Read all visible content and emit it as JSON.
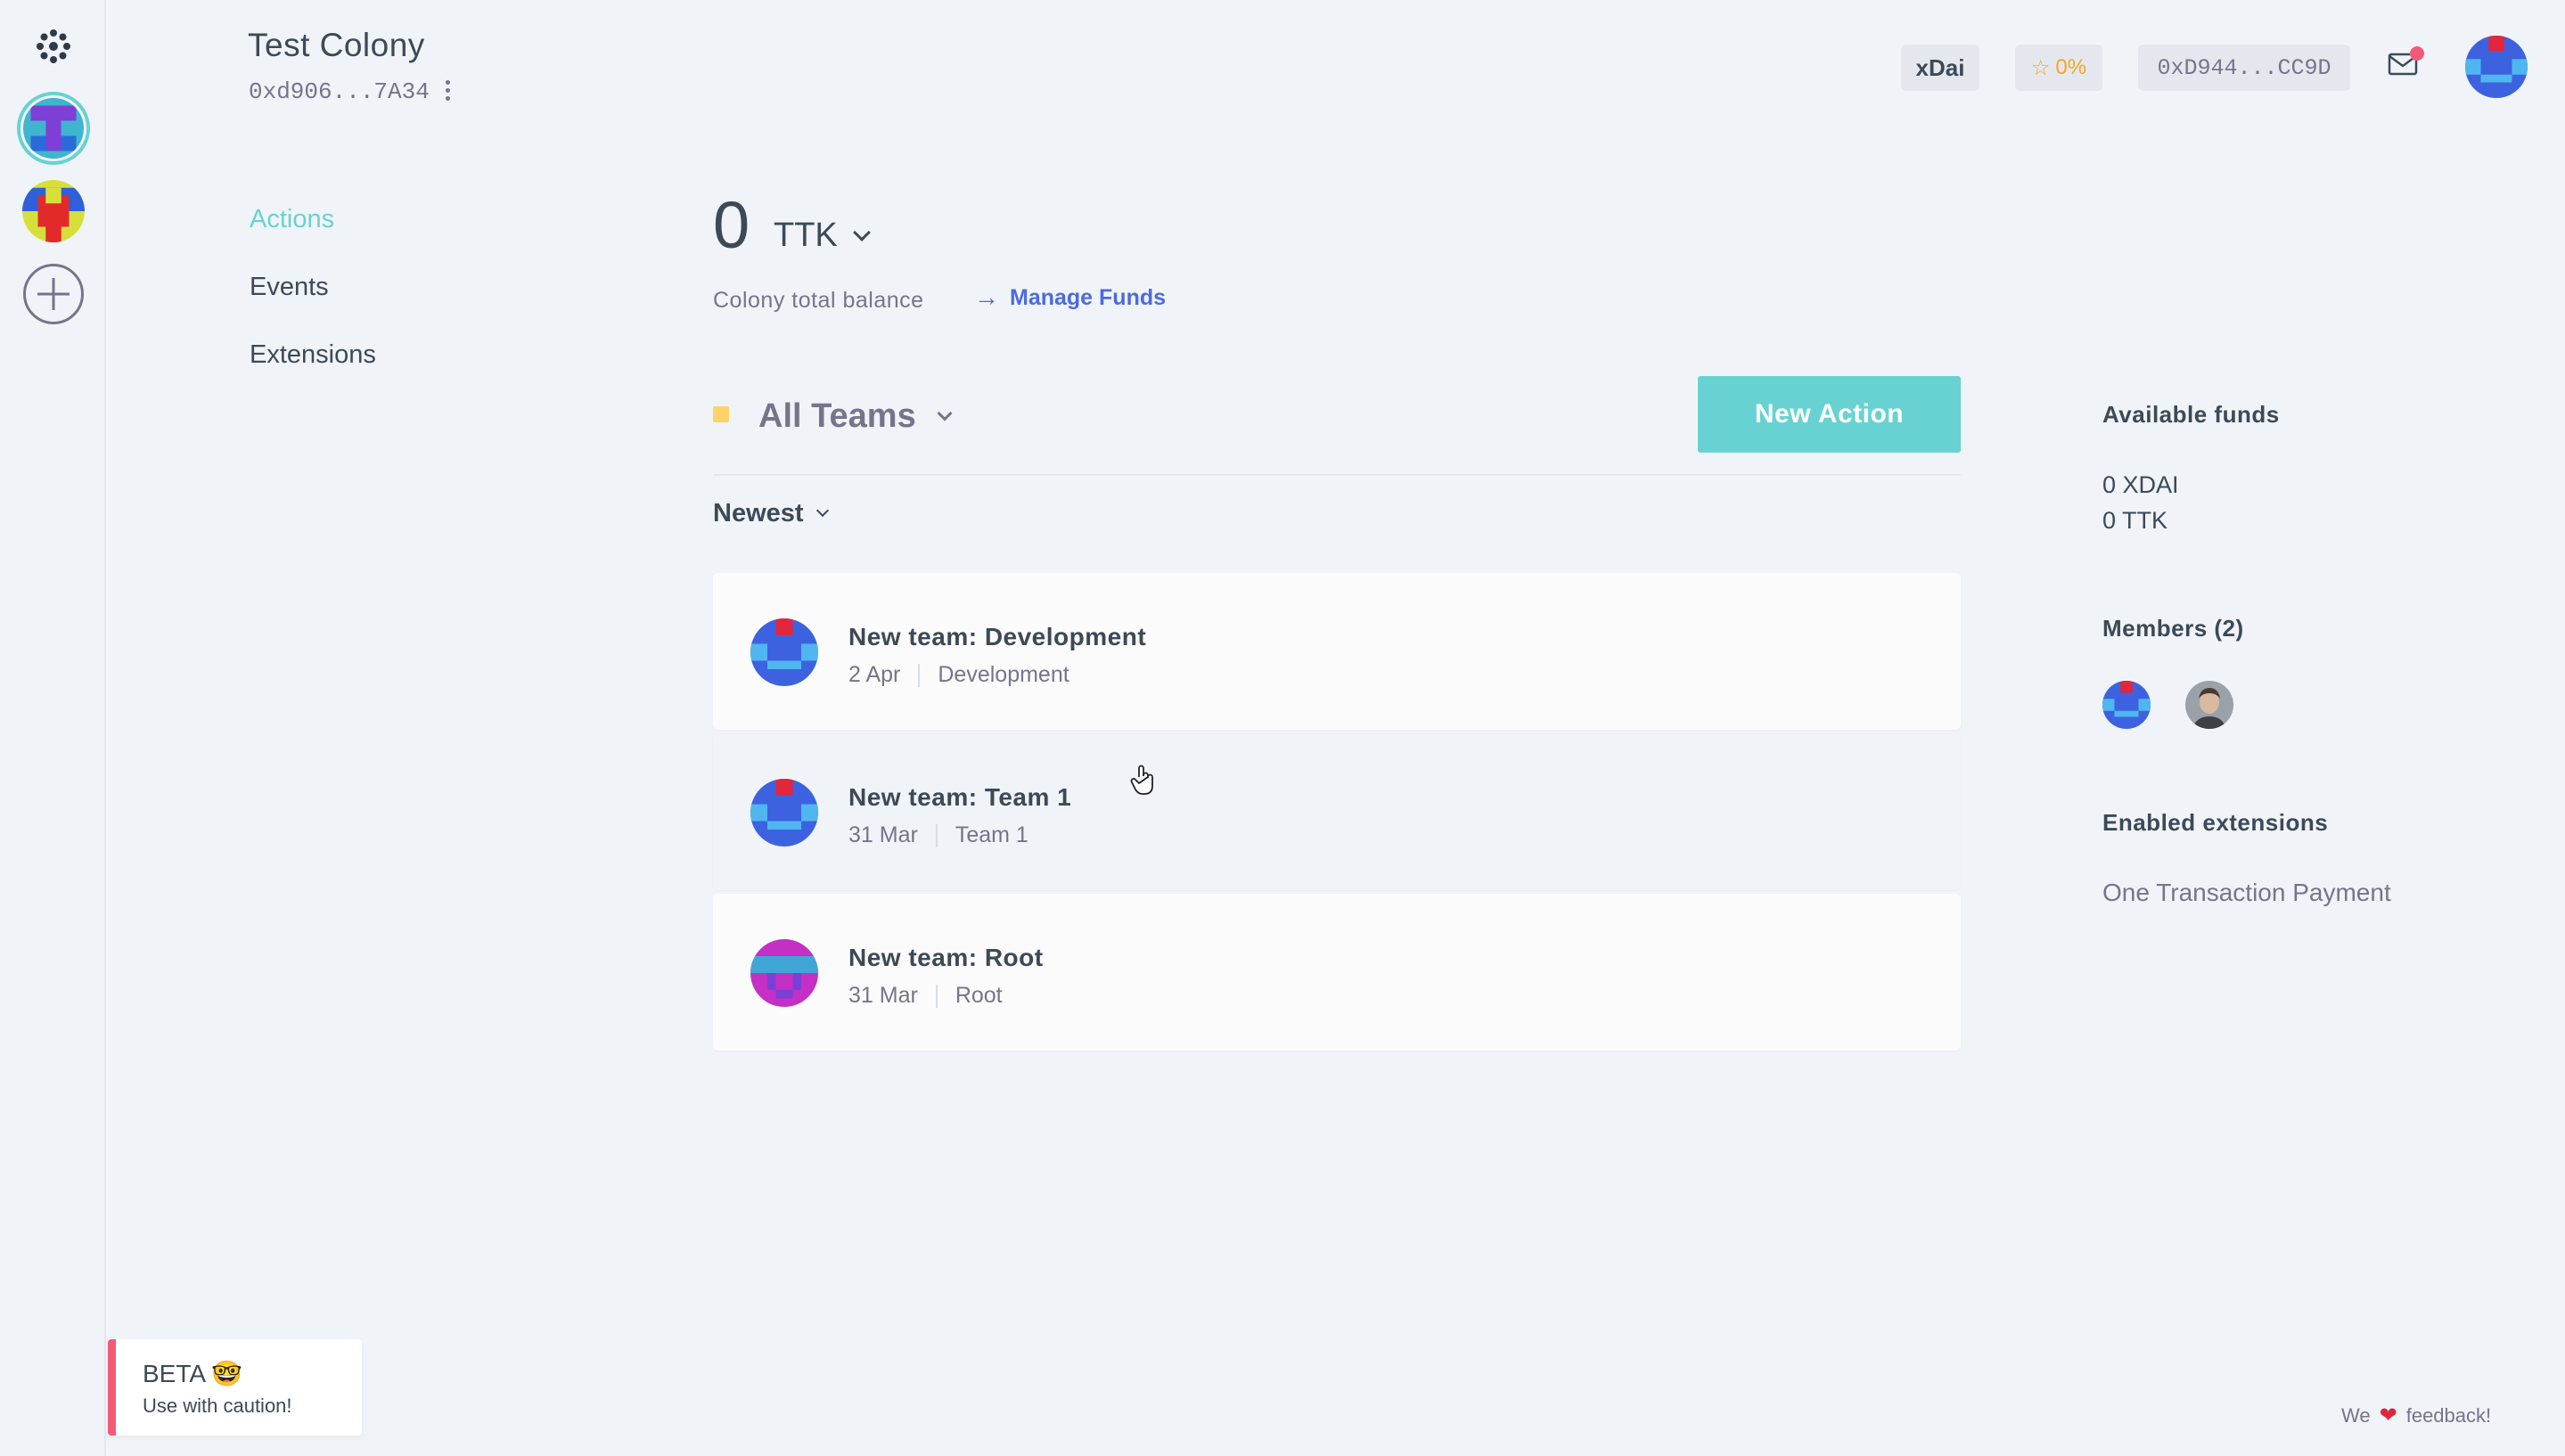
{
  "colony": {
    "name": "Test Colony",
    "address": "0xd906...7A34"
  },
  "header": {
    "network": "xDai",
    "reputation": "0%",
    "wallet": "0xD944...CC9D"
  },
  "subnav": {
    "items": [
      {
        "label": "Actions",
        "active": true
      },
      {
        "label": "Events",
        "active": false
      },
      {
        "label": "Extensions",
        "active": false
      }
    ]
  },
  "balance": {
    "amount": "0",
    "token": "TTK",
    "label": "Colony total balance",
    "manage_funds": "Manage Funds"
  },
  "teams": {
    "selected": "All Teams",
    "new_action": "New Action",
    "sort": "Newest"
  },
  "actions": [
    {
      "title": "New team: Development",
      "date": "2 Apr",
      "team": "Development"
    },
    {
      "title": "New team: Team 1",
      "date": "31 Mar",
      "team": "Team 1"
    },
    {
      "title": "New team: Root",
      "date": "31 Mar",
      "team": "Root"
    }
  ],
  "sidebar": {
    "funds_heading": "Available funds",
    "funds": [
      "0 XDAI",
      "0 TTK"
    ],
    "members_heading": "Members (2)",
    "extensions_heading": "Enabled extensions",
    "extensions": [
      "One Transaction Payment"
    ]
  },
  "beta": {
    "title": "BETA 🤓",
    "subtitle": "Use with caution!"
  },
  "feedback": {
    "before": "We",
    "after": "feedback!"
  },
  "colors": {
    "accent": "#68d2d2",
    "link": "#4d6ae0",
    "alert": "#f25b75",
    "team_dot": "#fdd366",
    "reputation": "#f5a623"
  }
}
